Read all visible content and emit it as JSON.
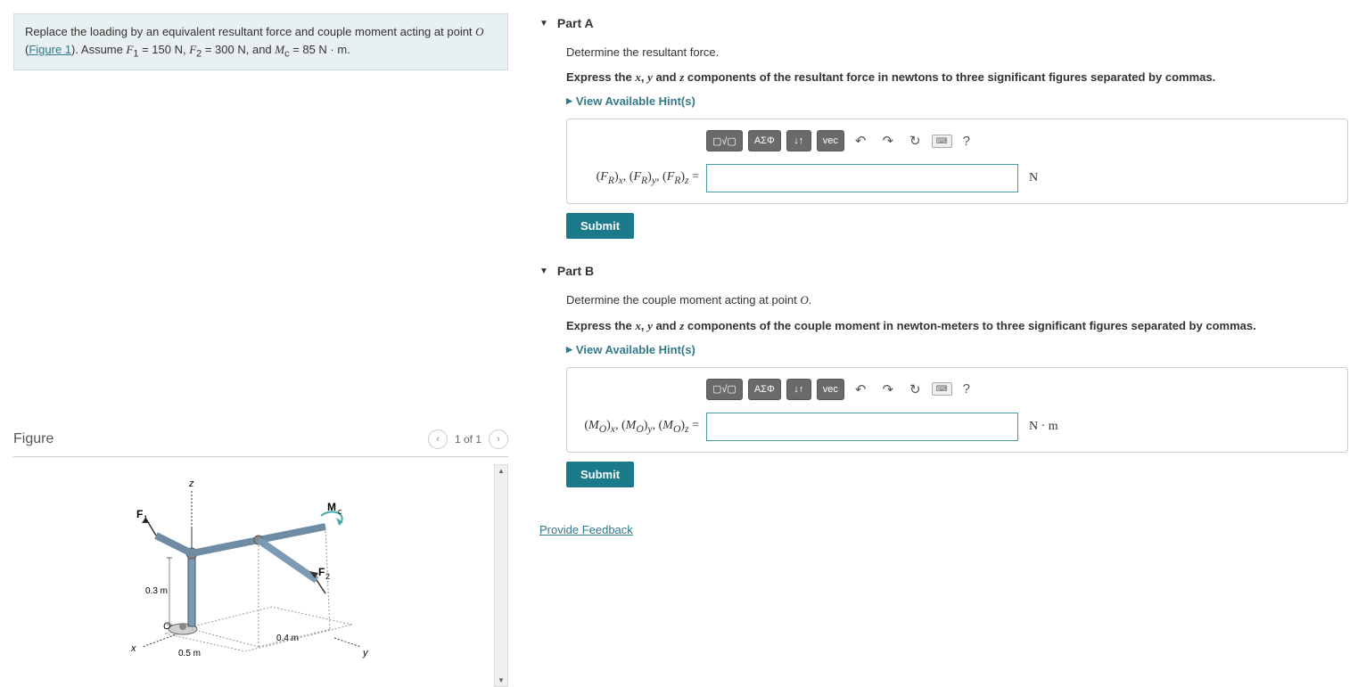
{
  "problem": {
    "intro_before_link": "Replace the loading by an equivalent resultant force and couple moment acting at point ",
    "point_var": "O",
    "link_text": "Figure 1",
    "intro_after_link": ". Assume ",
    "f1_var": "F",
    "f1_sub": "1",
    "eq": " = ",
    "f1_val": "150 N",
    "f2_var": "F",
    "f2_sub": "2",
    "f2_val": "300 N",
    "and": ", and ",
    "mc_var": "M",
    "mc_sub": "c",
    "mc_val": "85 N · m",
    "period": ".",
    "comma": ", "
  },
  "figure": {
    "title": "Figure",
    "counter": "1 of 1",
    "labels": {
      "z": "z",
      "x": "x",
      "y": "y",
      "F1": "F",
      "F1_sub": "1",
      "F2": "F",
      "F2_sub": "2",
      "Mc": "M",
      "Mc_sub": "c",
      "O": "O",
      "d1": "0.3 m",
      "d2": "0.5 m",
      "d3": "0.4 m"
    }
  },
  "partA": {
    "title": "Part A",
    "instr1": "Determine the resultant force.",
    "instr2_pre": "Express the ",
    "x": "x",
    "y": "y",
    "z": "z",
    "instr2_mid1": ", ",
    "instr2_mid2": " and ",
    "instr2_post": " components of the resultant force in newtons to three significant figures separated by commas.",
    "hints": "View Available Hint(s)",
    "label_html": "(F_R)_x, (F_R)_y, (F_R)_z =",
    "unit": "N",
    "submit": "Submit"
  },
  "partB": {
    "title": "Part B",
    "instr1_pre": "Determine the couple moment acting at point ",
    "instr1_var": "O",
    "instr1_post": ".",
    "instr2_pre": "Express the ",
    "x": "x",
    "y": "y",
    "z": "z",
    "instr2_mid1": ", ",
    "instr2_mid2": " and ",
    "instr2_post": " components of the couple moment in newton-meters to three significant figures separated by commas.",
    "hints": "View Available Hint(s)",
    "label_html": "(M_O)_x, (M_O)_y, (M_O)_z =",
    "unit": "N · m",
    "submit": "Submit"
  },
  "toolbar": {
    "templates": "▢√▢",
    "greek": "ΑΣΦ",
    "arrows": "↓↑",
    "vec": "vec",
    "undo": "↶",
    "redo": "↷",
    "reset": "↻",
    "keyboard": "⌨",
    "help": "?"
  },
  "feedback": "Provide Feedback"
}
